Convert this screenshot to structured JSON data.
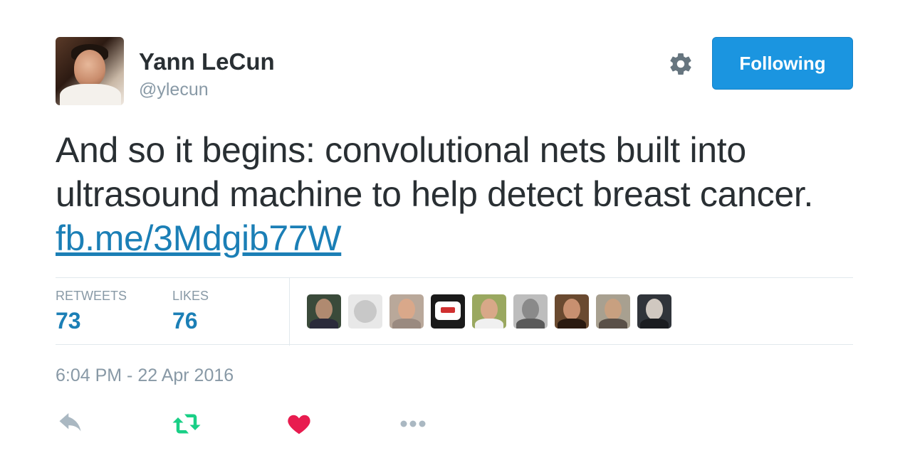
{
  "author": {
    "name": "Yann LeCun",
    "handle": "@ylecun"
  },
  "follow_button": {
    "label": "Following"
  },
  "tweet": {
    "lines": [
      "And so it begins: convolutional nets built into",
      "ultrasound machine to help detect breast cancer."
    ],
    "link": "fb.me/3Mdgib77W"
  },
  "stats": {
    "retweets_label": "RETWEETS",
    "retweets_count": "73",
    "likes_label": "LIKES",
    "likes_count": "76"
  },
  "timestamp": "6:04 PM - 22 Apr 2016",
  "colors": {
    "accent": "#1b95e0",
    "link": "#1b7fb6",
    "retweet_green": "#19cf86",
    "like_red": "#e81c4f",
    "muted": "#8899a6"
  },
  "icons": {
    "settings": "gear-icon",
    "reply": "reply-icon",
    "retweet": "retweet-icon",
    "like": "heart-icon",
    "more": "more-icon"
  }
}
